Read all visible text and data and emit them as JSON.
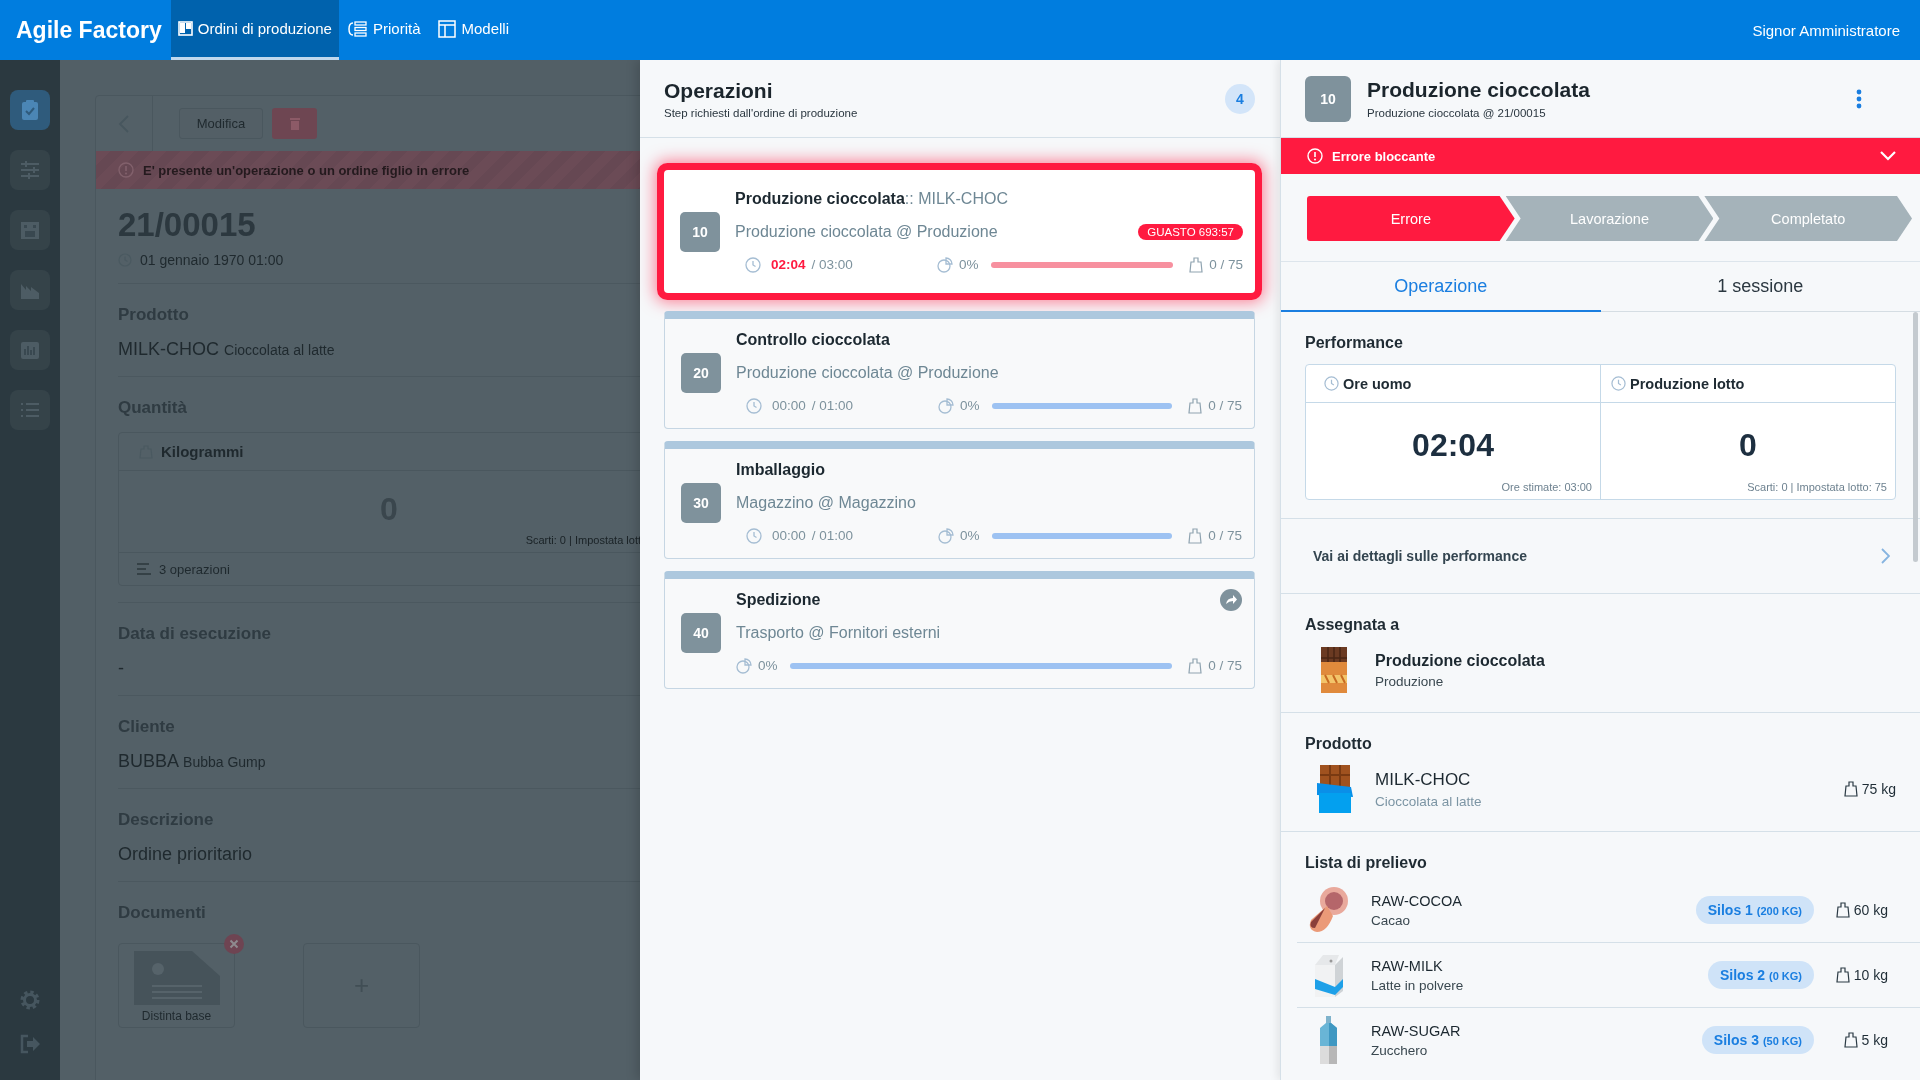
{
  "nav": {
    "brand": "Agile Factory",
    "user": "Signor Amministratore",
    "tabs": [
      {
        "label": "Ordini di produzione",
        "selected": true
      },
      {
        "label": "Priorità",
        "selected": false
      },
      {
        "label": "Modelli",
        "selected": false
      }
    ]
  },
  "rail": {
    "items": [
      {
        "selected": true
      },
      {
        "selected": false
      },
      {
        "selected": false
      },
      {
        "selected": false
      },
      {
        "selected": false
      },
      {
        "selected": false
      }
    ]
  },
  "order": {
    "edit_button": "Modifica",
    "alert": "E' presente un'operazione o un ordine figlio in errore",
    "code": "21/00015",
    "date": "01 gennaio 1970 01:00",
    "product": {
      "label": "Prodotto",
      "code": "MILK-CHOC",
      "name": "Cioccolata al latte"
    },
    "quantity": {
      "label": "Quantità",
      "unit": "Kilogrammi",
      "value": "0",
      "note": "Scarti: 0 | Impostata lott",
      "footer": "3 operazioni"
    },
    "execution_date": {
      "label": "Data di esecuzione",
      "value": "-"
    },
    "customer": {
      "label": "Cliente",
      "code": "BUBBA",
      "name": "Bubba Gump"
    },
    "description": {
      "label": "Descrizione",
      "value": "Ordine prioritario"
    },
    "documents": {
      "label": "Documenti",
      "items": [
        {
          "name": "Distinta base"
        }
      ],
      "add": "+"
    }
  },
  "operations": {
    "title": "Operazioni",
    "subtitle": "Step richiesti dall'ordine di produzione",
    "count": "4",
    "items": [
      {
        "kind": "internal",
        "number": "10",
        "title": "Produzione cioccolata",
        "product": ":: MILK-CHOC",
        "location": "Produzione cioccolata @ Produzione",
        "alert": "GUASTO 693:57",
        "time_spent": "02:04",
        "time_planned": "/ 03:00",
        "progress": "0%",
        "level": 0,
        "quantity": "0 / 75",
        "error": true,
        "selected": true
      },
      {
        "kind": "internal",
        "number": "20",
        "title": "Controllo cioccolata",
        "location": "Produzione cioccolata @ Produzione",
        "time_spent": "00:00",
        "time_planned": "/ 01:00",
        "progress": "0%",
        "level": 0,
        "quantity": "0 / 75",
        "error": false,
        "selected": false
      },
      {
        "kind": "internal",
        "number": "30",
        "title": "Imballaggio",
        "location": "Magazzino @ Magazzino",
        "time_spent": "00:00",
        "time_planned": "/ 01:00",
        "progress": "0%",
        "level": 0,
        "quantity": "0 / 75",
        "error": false,
        "selected": false
      },
      {
        "kind": "external",
        "number": "40",
        "title": "Spedizione",
        "location": "Trasporto @ Fornitori esterni",
        "progress": "0%",
        "level": 0,
        "quantity": "0 / 75",
        "error": false,
        "selected": false
      }
    ]
  },
  "detail": {
    "number": "10",
    "title": "Produzione cioccolata",
    "subtitle": "Produzione cioccolata @ 21/00015",
    "error_bar": "Errore bloccante",
    "steps": [
      {
        "label": "Errore",
        "selected": true
      },
      {
        "label": "Lavorazione",
        "selected": false
      },
      {
        "label": "Completato",
        "selected": false
      }
    ],
    "tabs": [
      {
        "label": "Operazione",
        "selected": true
      },
      {
        "label": "1 sessione",
        "selected": false
      }
    ],
    "performance": {
      "title": "Performance",
      "link": "Vai ai dettagli sulle performance",
      "cells": [
        {
          "label": "Ore uomo",
          "value": "02:04",
          "note": "Ore stimate: 03:00"
        },
        {
          "label": "Produzione lotto",
          "value": "0",
          "note": "Scarti: 0 | Impostata lotto: 75"
        }
      ]
    },
    "assigned": {
      "title": "Assegnata a",
      "name": "Produzione cioccolata",
      "sub": "Produzione"
    },
    "product": {
      "title": "Prodotto",
      "code": "MILK-CHOC",
      "name": "Cioccolata al latte",
      "quantity": "75 kg"
    },
    "picking": {
      "title": "Lista di prelievo",
      "items": [
        {
          "kind": "cocoa",
          "code": "RAW-COCOA",
          "name": "Cacao",
          "silo": "Silos 1",
          "stock": "(200 KG)",
          "quantity": "60 kg"
        },
        {
          "kind": "milk",
          "code": "RAW-MILK",
          "name": "Latte in polvere",
          "silo": "Silos 2",
          "stock": "(0 KG)",
          "quantity": "10 kg"
        },
        {
          "kind": "sugar",
          "code": "RAW-SUGAR",
          "name": "Zucchero",
          "silo": "Silos 3",
          "stock": "(50 KG)",
          "quantity": "5 kg"
        }
      ]
    }
  }
}
